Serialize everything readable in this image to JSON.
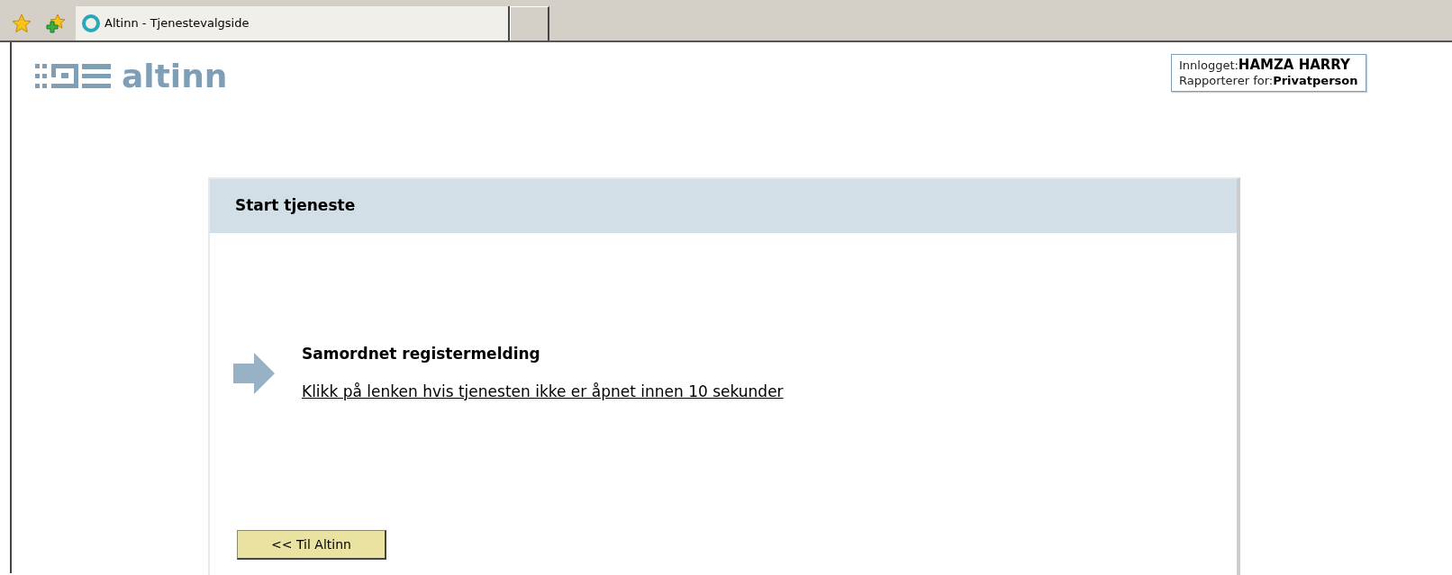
{
  "browser_tab": {
    "title": "Altinn - Tjenestevalgside"
  },
  "logo": {
    "text": "altinn"
  },
  "login_info": {
    "user_label": "Innlogget:",
    "user": "HAMZA HARRY",
    "reporting_label": "Rapporterer for:",
    "reporting": "Privatperson"
  },
  "panel": {
    "title": "Start tjeneste",
    "service_name": "Samordnet registermelding",
    "link": "Klikk på lenken hvis tjenesten ikke er åpnet innen 10 sekunder",
    "back_button": "<< Til Altinn"
  }
}
